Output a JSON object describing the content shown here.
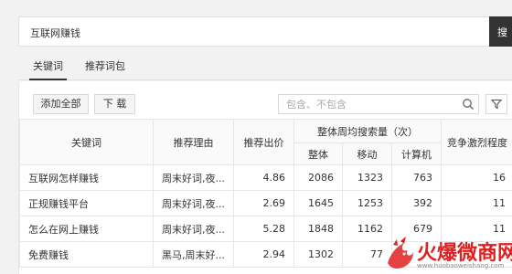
{
  "search": {
    "query": "互联网赚钱",
    "button_label": "搜"
  },
  "tabs": [
    {
      "label": "关键词"
    },
    {
      "label": "推荐词包"
    }
  ],
  "toolbar": {
    "add_all_label": "添加全部",
    "download_label": "下 载",
    "filter_placeholder": "包含、不包含",
    "search_icon": "search-icon",
    "filter_icon": "funnel-icon"
  },
  "table": {
    "headers": {
      "keyword": "关键词",
      "reason": "推荐理由",
      "bid": "推荐出价",
      "volume_group": "整体周均搜索量（次）",
      "volume_total": "整体",
      "volume_mobile": "移动",
      "volume_pc": "计算机",
      "competition": "竞争激烈程度"
    },
    "rows": [
      {
        "keyword": "互联网怎样赚钱",
        "reason": "周末好词,夜...",
        "bid": "4.86",
        "total": "2086",
        "mobile": "1323",
        "pc": "763",
        "competition": "16"
      },
      {
        "keyword": "正规赚钱平台",
        "reason": "周末好词,夜...",
        "bid": "2.69",
        "total": "1645",
        "mobile": "1253",
        "pc": "392",
        "competition": "11"
      },
      {
        "keyword": "怎么在网上赚钱",
        "reason": "周末好词,夜...",
        "bid": "5.28",
        "total": "1848",
        "mobile": "1162",
        "pc": "679",
        "competition": "11"
      },
      {
        "keyword": "免费赚钱",
        "reason": "黑马,周末好...",
        "bid": "2.94",
        "total": "1302",
        "mobile": "77",
        "pc": "",
        "competition": ""
      }
    ]
  },
  "watermark": {
    "title": "火爆微商网",
    "url": "www.huobaoweishang.com"
  },
  "colors": {
    "dark_button": "#333333",
    "watermark_red": "#e02020"
  }
}
